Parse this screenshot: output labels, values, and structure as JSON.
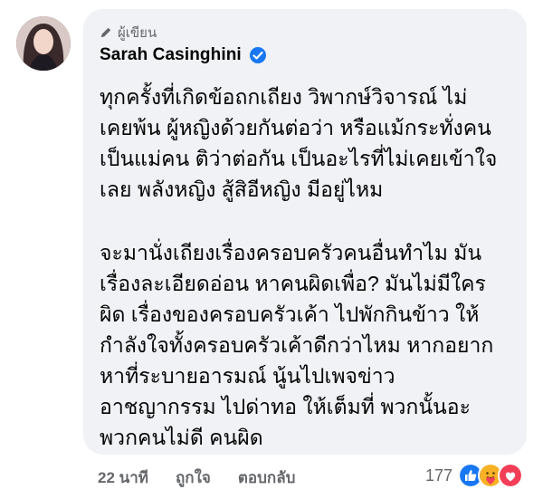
{
  "comment": {
    "author_role": "ผู้เขียน",
    "author_name": "Sarah Casinghini",
    "body_lines": [
      "ทุกครั้งที่เกิดข้อถกเถียง วิพากษ์วิจารณ์ ไม่",
      "เคยพ้น ผู้หญิงด้วยกันต่อว่า หรือแม้กระทั่งคน",
      "เป็นแม่คน ติว่าต่อกัน เป็นอะไรที่ไม่เคยเข้าใจ",
      "เลย พลังหญิง สู้สิอีหญิง มีอยู่ไหม",
      "",
      "จะมานั่งเถียงเรื่องครอบครัวคนอื่นทำไม มัน",
      "เรื่องละเอียดอ่อน หาคนผิดเพื่อ? มันไม่มีใคร",
      "ผิด เรื่องของครอบครัวเค้า ไปพักกินข้าว ให้",
      "กำลังใจทั้งครอบครัวเค้าดีกว่าไหม หากอยาก",
      "หาที่ระบายอารมณ์ นู้นไปเพจข่าว",
      "อาชญากรรม ไปด่าทอ ให้เต็มที่ พวกนั้นอะ",
      "พวกคนไม่ดี คนผิด"
    ]
  },
  "footer": {
    "time": "22 นาที",
    "like_label": "ถูกใจ",
    "reply_label": "ตอบกลับ"
  },
  "reactions": {
    "count": "177",
    "icons": [
      "like-icon",
      "care-icon",
      "love-icon"
    ],
    "colors": {
      "like": "#1877f2",
      "care": "#f7b125",
      "love": "#f33e58"
    }
  },
  "colors": {
    "bubble": "#f0f2f5",
    "verified": "#1877f2",
    "muted": "#65676b"
  }
}
